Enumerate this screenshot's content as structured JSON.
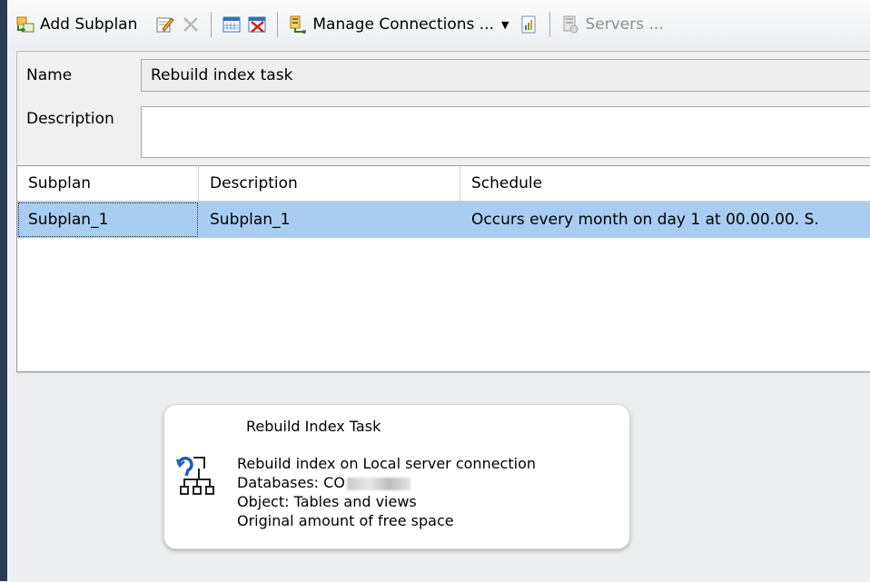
{
  "toolbar": {
    "add_subplan": "Add Subplan",
    "manage_connections": "Manage Connections ...",
    "servers": "Servers ..."
  },
  "form": {
    "name_label": "Name",
    "name_value": "Rebuild index task",
    "description_label": "Description",
    "description_value": ""
  },
  "grid": {
    "columns": [
      "Subplan",
      "Description",
      "Schedule"
    ],
    "rows": [
      [
        "Subplan_1",
        "Subplan_1",
        "Occurs every month on day 1 at 00.00.00. S."
      ]
    ]
  },
  "task": {
    "title": "Rebuild Index Task",
    "line1": "Rebuild index on Local server connection",
    "line2": "Databases: CO",
    "line3": "Object: Tables and views",
    "line4": "Original amount of free space",
    "icon": "rebuild-index-icon"
  },
  "colors": {
    "selected_row": "#a8cdf0",
    "left_strip": "#2b3a55",
    "icon_blue": "#1c5fb8"
  }
}
